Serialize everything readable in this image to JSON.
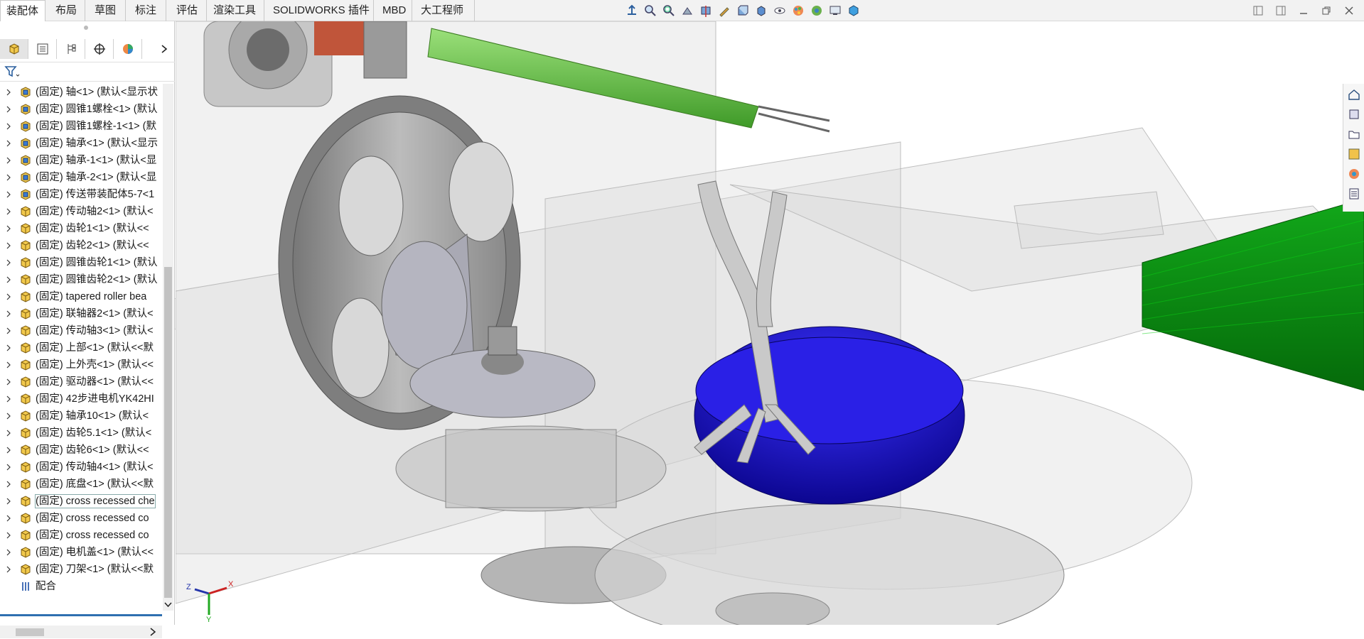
{
  "tabs": [
    {
      "label": "装配体",
      "active": true
    },
    {
      "label": "布局",
      "active": false
    },
    {
      "label": "草图",
      "active": false
    },
    {
      "label": "标注",
      "active": false
    },
    {
      "label": "评估",
      "active": false
    },
    {
      "label": "渲染工具",
      "active": false
    },
    {
      "label": "SOLIDWORKS 插件",
      "active": false
    },
    {
      "label": "MBD",
      "active": false
    },
    {
      "label": "大工程师",
      "active": false
    }
  ],
  "view_toolbar_icons": [
    "view-orientation-icon",
    "zoom-to-fit-icon",
    "zoom-area-icon",
    "previous-view-icon",
    "section-view-icon",
    "dynamic-annotation-icon",
    "view-orientation-menu-icon",
    "display-style-icon",
    "hide-show-items-icon",
    "edit-appearance-icon",
    "apply-scene-icon",
    "view-settings-icon",
    "3d-view-icon"
  ],
  "window_controls": [
    "tile-left-icon",
    "tile-right-icon",
    "minimize-icon",
    "restore-icon",
    "close-icon"
  ],
  "panel_tabs": [
    "featuremanager-icon",
    "propertymanager-icon",
    "configurationmanager-icon",
    "dimxpert-icon",
    "display-manager-icon"
  ],
  "tree": {
    "items": [
      {
        "label": "(固定) 轴<1> (默认<显示状",
        "icon": "subassembly"
      },
      {
        "label": "(固定) 圆锥1螺栓<1> (默认",
        "icon": "subassembly"
      },
      {
        "label": "(固定) 圆锥1螺栓-1<1> (默",
        "icon": "subassembly"
      },
      {
        "label": "(固定) 轴承<1> (默认<显示",
        "icon": "subassembly"
      },
      {
        "label": "(固定) 轴承-1<1> (默认<显",
        "icon": "subassembly"
      },
      {
        "label": "(固定) 轴承-2<1> (默认<显",
        "icon": "subassembly"
      },
      {
        "label": "(固定) 传送带装配体5-7<1",
        "icon": "subassembly"
      },
      {
        "label": "(固定) 传动轴2<1> (默认<",
        "icon": "part"
      },
      {
        "label": "(固定) 齿轮1<1> (默认<<",
        "icon": "part"
      },
      {
        "label": "(固定) 齿轮2<1> (默认<<",
        "icon": "part"
      },
      {
        "label": "(固定) 圆锥齿轮1<1> (默认",
        "icon": "part"
      },
      {
        "label": "(固定) 圆锥齿轮2<1> (默认",
        "icon": "part"
      },
      {
        "label": "(固定) tapered roller bea",
        "icon": "part"
      },
      {
        "label": "(固定) 联轴器2<1> (默认<",
        "icon": "part"
      },
      {
        "label": "(固定) 传动轴3<1> (默认<",
        "icon": "part"
      },
      {
        "label": "(固定) 上部<1> (默认<<默",
        "icon": "part"
      },
      {
        "label": "(固定) 上外壳<1> (默认<<",
        "icon": "part"
      },
      {
        "label": "(固定) 驱动器<1> (默认<<",
        "icon": "part"
      },
      {
        "label": "(固定) 42步进电机YK42HI",
        "icon": "part"
      },
      {
        "label": "(固定) 轴承10<1> (默认<",
        "icon": "part"
      },
      {
        "label": "(固定) 齿轮5.1<1> (默认<",
        "icon": "part"
      },
      {
        "label": "(固定) 齿轮6<1> (默认<<",
        "icon": "part"
      },
      {
        "label": "(固定) 传动轴4<1> (默认<",
        "icon": "part"
      },
      {
        "label": "(固定) 底盘<1> (默认<<默",
        "icon": "part"
      },
      {
        "label": "(固定) cross recessed che",
        "icon": "part",
        "selected": true
      },
      {
        "label": "(固定) cross recessed co",
        "icon": "part"
      },
      {
        "label": "(固定) cross recessed co",
        "icon": "part"
      },
      {
        "label": "(固定) 电机盖<1> (默认<<",
        "icon": "part"
      },
      {
        "label": "(固定) 刀架<1> (默认<<默",
        "icon": "part"
      }
    ],
    "mates_label": "配合"
  },
  "triad": {
    "x": "X",
    "y": "Y",
    "z": "Z"
  },
  "colors": {
    "part_yellow": "#f2c94c",
    "subassembly_blue": "#3a7bd5",
    "bowl_blue": "#1a12c8",
    "green_shaft": "#6cc04a",
    "belt_green": "#0a8a10"
  }
}
